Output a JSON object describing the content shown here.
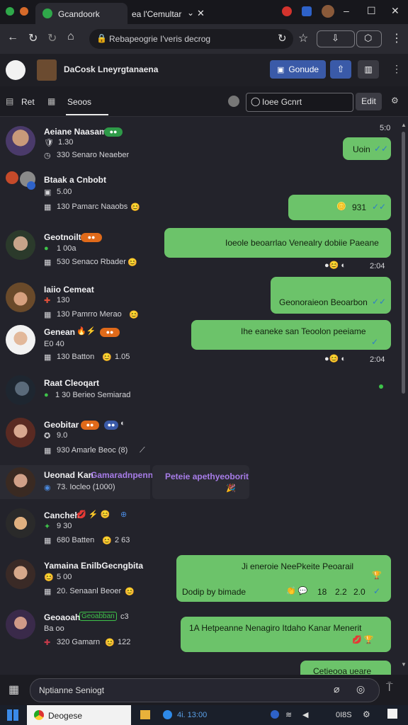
{
  "browser": {
    "tab_title": "Gcandoork",
    "tab2_title": "ea l'Cemultar",
    "omnibox_text": "Rebapeogrie I'veris decrog",
    "window_buttons": [
      "–",
      "☐",
      "✕"
    ]
  },
  "app": {
    "header_title": "DaCosk Lneyrgtanaena",
    "primary_button": "Gonude"
  },
  "subtabs": {
    "tab1": "Ret",
    "tab2": "Seoos",
    "search_placeholder": "Ioee Gcnrt",
    "edit_button": "Edit"
  },
  "chat": {
    "left_items": [
      {
        "name": "Aeiane Naasam",
        "line1": "1.30",
        "line2": "330 Senaro Neaeber"
      },
      {
        "name": "Btaak a Cnbobt",
        "line1": "5.00",
        "line2": "130 Pamarc Naaobs"
      },
      {
        "name": "Geotnoilt",
        "line1": "1 00a",
        "line2": "530 Senaco Rbader"
      },
      {
        "name": "Iaiio Cemeat",
        "line1": "130",
        "line2": "130 Pamrro Merao"
      },
      {
        "name": "Genean",
        "line1": "E0 40",
        "line2": "130 Batton",
        "extra": "1.05"
      },
      {
        "name": "Raat Cleoqart",
        "line1": "",
        "line2": "1 30 Berieo Semiarad"
      },
      {
        "name": "Geobitar",
        "line1": "9.0",
        "line2": "930 Amarle Beoc (8)"
      },
      {
        "name": "Ueonad Kan",
        "highlight": "Gamaradnpenne",
        "line2": "73. Iocleo (1000)"
      },
      {
        "name": "Cancheh",
        "line1": "9 30",
        "line2": "680 Batten",
        "extra": "2 63"
      },
      {
        "name": "Yamaina EnilbGecngbita",
        "line1": "5 00",
        "line2": "20. Senaanl Beoer"
      },
      {
        "name": "Geoaoah",
        "tag": "Geoabban",
        "tag_extra": "c3",
        "line1": "Ba oo",
        "line2": "320 Gamarn",
        "extra": "122"
      }
    ],
    "right_bubbles": [
      {
        "text": "Uoin",
        "time": "5:0"
      },
      {
        "text": "931"
      },
      {
        "text": "Ioeole beoarrlao Venealry dobiie Paeane",
        "time": "2:04"
      },
      {
        "text": "Geonoraieon Beoarbon"
      },
      {
        "text": "Ihe eaneke san Teoolon peeiame",
        "time": "2:04"
      },
      {
        "text": "Ji eneroie NeePkeite Peoarail",
        "sub": "Dodip by bimade",
        "nums": [
          "18",
          "2.2",
          "2.0"
        ]
      },
      {
        "text": "1A Hetpeanne Nenagiro Itdaho Kanar Menerit"
      },
      {
        "text": "Cetieooa ueare"
      }
    ],
    "mid_bubble": {
      "text": "Peteie apethyeoborit"
    }
  },
  "compose": {
    "placeholder": "Nptianne Seniogt"
  },
  "taskbar": {
    "app1": "Deogese",
    "app2": "4i. 13:00",
    "clock": "0I8S"
  },
  "colors": {
    "bubble": "#6cc36a",
    "accent_blue": "#3a5aa8",
    "badge_green": "#2e9a48",
    "badge_orange": "#e06a1a",
    "read_tick": "#2d7dc8"
  }
}
